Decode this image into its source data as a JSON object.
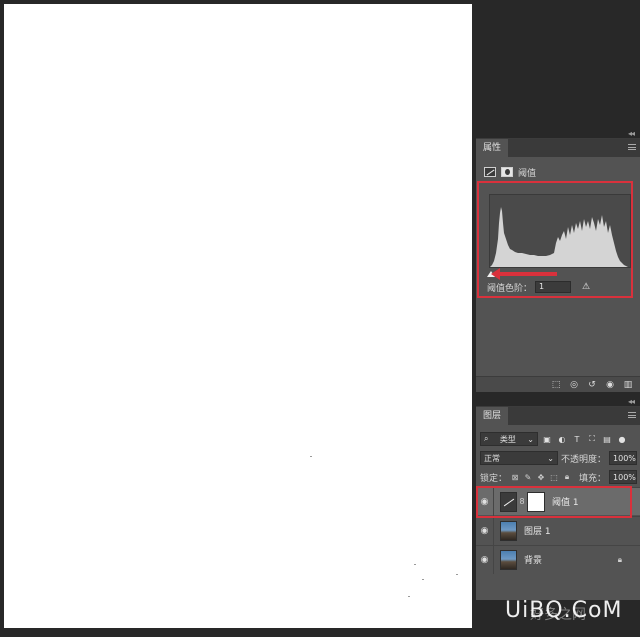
{
  "properties_panel": {
    "tab": "属性",
    "adjustment_name": "阈值",
    "threshold_level_label": "阈值色阶：",
    "threshold_level_value": "1",
    "icons": [
      "threshold-adjustment-icon",
      "layer-mask-icon",
      "warning-icon",
      "clip-to-layer-icon",
      "view-previous-icon",
      "reset-icon",
      "visibility-icon",
      "trash-icon"
    ]
  },
  "layers_panel": {
    "tab": "图层",
    "filter_kind": "类型",
    "blend_mode": "正常",
    "opacity_label": "不透明度：",
    "opacity_value": "100%",
    "lock_label": "锁定：",
    "fill_label": "填充：",
    "fill_value": "100%",
    "layers": [
      {
        "name": "阈值 1",
        "kind": "adjustment",
        "selected": true,
        "visible": true
      },
      {
        "name": "图层 1",
        "kind": "pixel",
        "selected": false,
        "visible": true
      },
      {
        "name": "背景",
        "kind": "background",
        "selected": false,
        "visible": true,
        "locked": true
      }
    ]
  },
  "watermark": {
    "text": "UiBQ.CoM",
    "faint_text": "好多之网"
  },
  "colors": {
    "highlight": "#d9313c",
    "panel": "#535353",
    "workspace": "#282828"
  }
}
